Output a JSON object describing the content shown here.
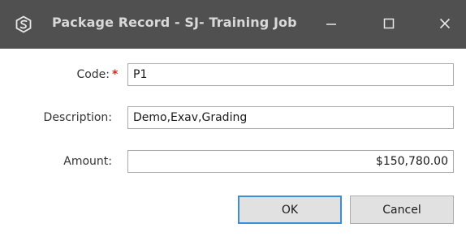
{
  "window": {
    "title": "Package Record - SJ- Training Job",
    "minimize_icon": "minimize-icon",
    "maximize_icon": "maximize-icon",
    "close_icon": "close-icon",
    "app_icon": "cube-logo-icon"
  },
  "form": {
    "code_label": "Code:",
    "code_required_marker": "*",
    "code_value": "P1",
    "description_label": "Description:",
    "description_value": "Demo,Exav,Grading",
    "amount_label": "Amount:",
    "amount_value": "$150,780.00"
  },
  "buttons": {
    "ok_label": "OK",
    "cancel_label": "Cancel"
  },
  "colors": {
    "titlebar": "#505050",
    "required": "#e0241b",
    "default_button_border": "#3b8fd8"
  }
}
